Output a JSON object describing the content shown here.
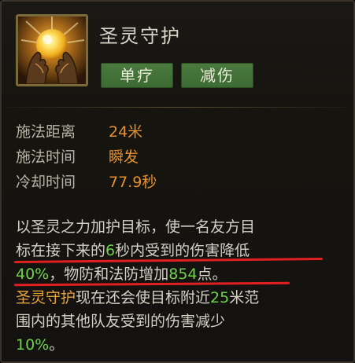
{
  "skill": {
    "name": "圣灵守护",
    "icon": "holy-orb-hands-icon",
    "tags": [
      "单疗",
      "减伤"
    ]
  },
  "stats": [
    {
      "label": "施法距离",
      "value": "24米"
    },
    {
      "label": "施法时间",
      "value": "瞬发"
    },
    {
      "label": "冷却时间",
      "value": "77.9秒"
    }
  ],
  "description": {
    "line1": "以圣灵之力加护目标，使一名友方目",
    "line2_a": "标在接下来的",
    "line2_b": "6",
    "line2_c": "秒内受到的伤害降低",
    "line3_a": "40%",
    "line3_b": "，物防和法防增加",
    "line3_c": "854",
    "line3_d": "点。",
    "line4_a": "圣灵守护",
    "line4_b": "现在还会使目标附近",
    "line4_c": "25",
    "line4_d": "米范",
    "line5": "围内的其他队友受到的伤害减少",
    "line6": "10%",
    "line6_b": "。"
  },
  "colors": {
    "value_orange": "#e6902e",
    "highlight_green": "#6fd24a",
    "highlight_orange": "#e8a23a",
    "tag_green": "#4a7a3e",
    "underline_red": "#e02020"
  }
}
